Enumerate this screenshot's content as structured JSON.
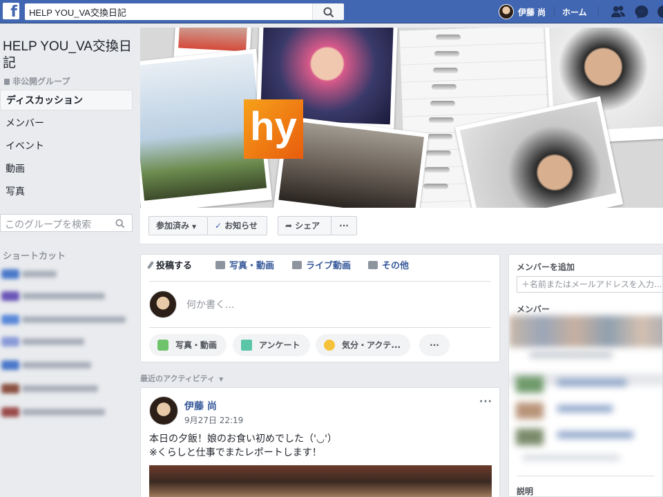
{
  "topbar": {
    "logo_letter": "f",
    "search_value": "HELP YOU_VA交換日記",
    "user_name": "伊藤 尚",
    "home_label": "ホーム",
    "icons": [
      "friends-icon",
      "messenger-icon",
      "globe-icon"
    ],
    "brand_color": "#4267b2"
  },
  "sidebar": {
    "group_name": "HELP YOU_VA交換日記",
    "privacy": "非公開グループ",
    "nav": [
      {
        "label": "ディスカッション",
        "active": true
      },
      {
        "label": "メンバー"
      },
      {
        "label": "イベント"
      },
      {
        "label": "動画"
      },
      {
        "label": "写真"
      }
    ],
    "search_placeholder": "このグループを検索",
    "shortcuts_title": "ショートカット"
  },
  "cover": {
    "logo_text": "hy"
  },
  "cover_actions": {
    "joined_label": "参加済み",
    "notify_label": "お知らせ",
    "share_label": "シェア",
    "more_label": "···"
  },
  "composer": {
    "tabs": [
      "投稿する",
      "写真・動画",
      "ライブ動画",
      "その他"
    ],
    "placeholder": "何か書く...",
    "actions": [
      "写真・動画",
      "アンケート",
      "気分・アクテ..."
    ],
    "more_label": "···"
  },
  "activity": {
    "label": "最近のアクティビティ"
  },
  "post": {
    "author": "伊藤 尚",
    "time": "9月27日 22:19",
    "more_label": "···",
    "text_line1": "本日の夕飯！娘のお食い初めでした（'◡'）",
    "text_line2": "※くらしと仕事でまたレポートします！"
  },
  "right": {
    "add_member_title": "メンバーを追加",
    "add_member_placeholder": "＋名前またはメールアドレスを入力...",
    "members_title": "メンバー",
    "description_title": "説明"
  }
}
